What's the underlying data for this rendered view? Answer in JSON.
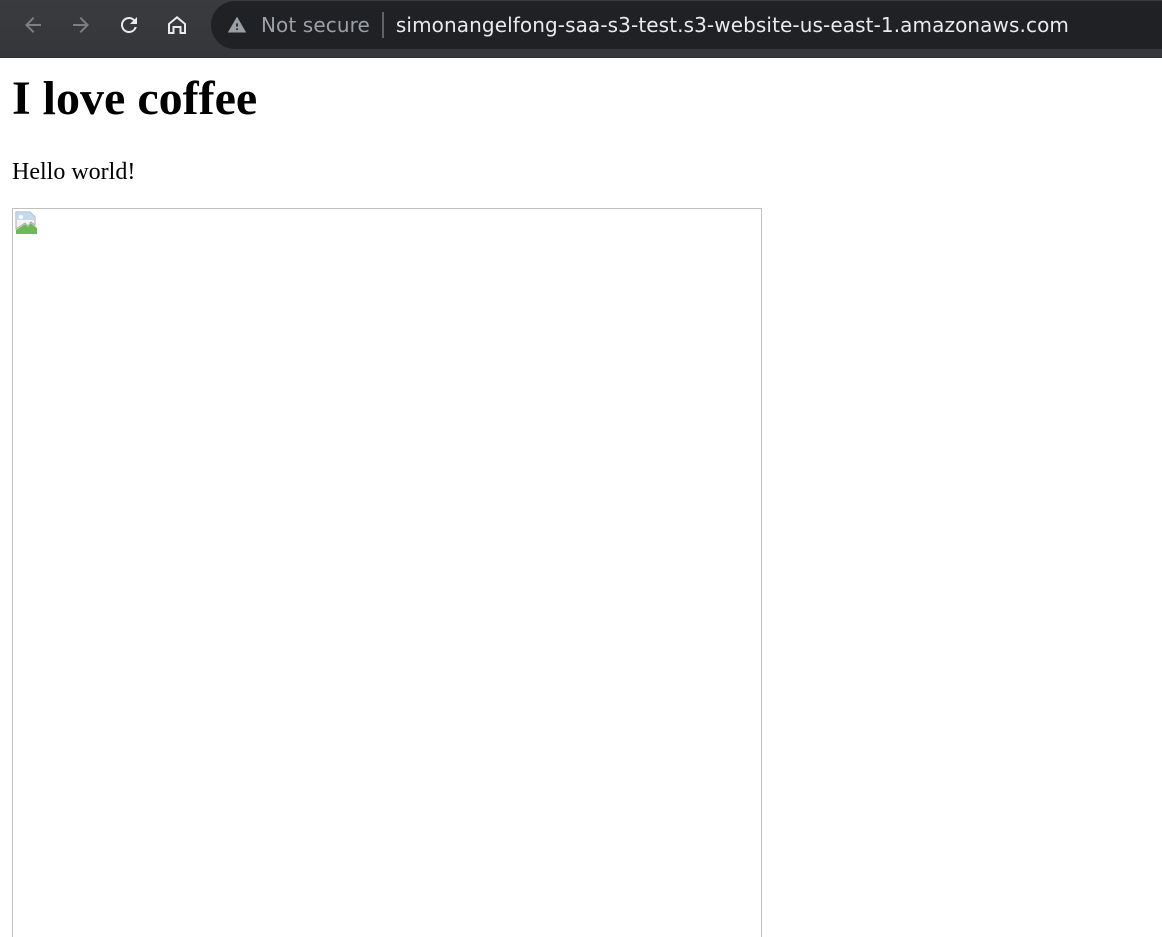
{
  "browser": {
    "security_label": "Not secure",
    "url": "simonangelfong-saa-s3-test.s3-website-us-east-1.amazonaws.com",
    "icons": {
      "back": "arrow-left-icon",
      "forward": "arrow-right-icon",
      "reload": "reload-icon",
      "home": "home-icon",
      "security": "warning-triangle-icon"
    }
  },
  "page": {
    "title": "I love coffee",
    "text": "Hello world!",
    "image": {
      "state": "broken",
      "icon": "broken-image-icon"
    }
  },
  "colors": {
    "toolbar": "#35363a",
    "omnibox": "#202124",
    "url": "#e8eaed",
    "security_label": "#9aa0a6"
  }
}
